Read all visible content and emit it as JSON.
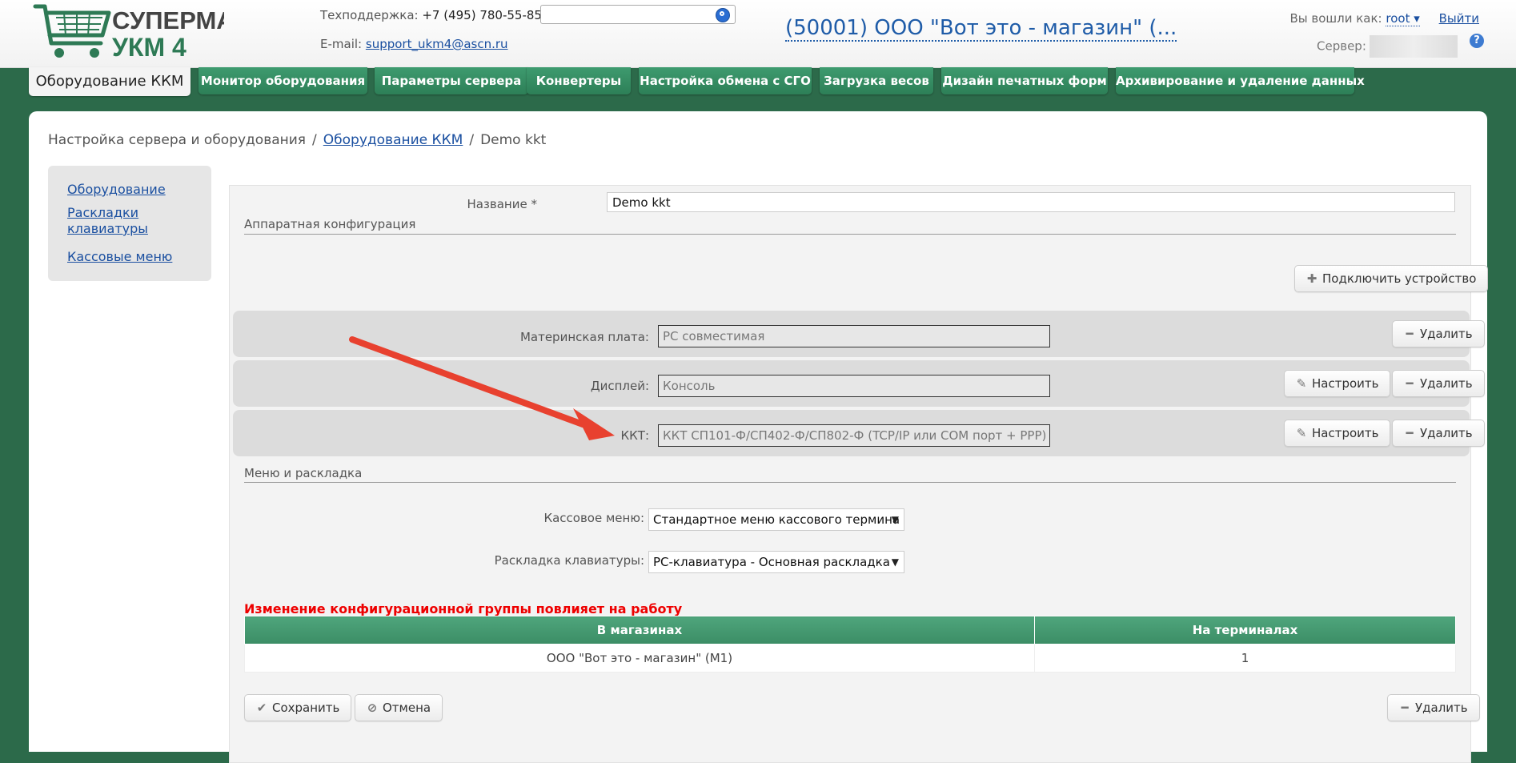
{
  "header": {
    "brand_line1": "СУПЕРМАГ",
    "brand_line2": "УКМ 4",
    "support_label": "Техподдержка:",
    "support_phone": "+7 (495) 780-55-85",
    "email_label": "E-mail:",
    "email": "support_ukm4@ascn.ru",
    "search_value": "",
    "org_title": "(50001) ООО \"Вот это - магазин\" (...",
    "logged_in_label": "Вы вошли как:",
    "user": "root",
    "logout": "Выйти",
    "server_label": "Сервер:",
    "help": "?"
  },
  "tabs": [
    {
      "label": "Оборудование ККМ",
      "active": true
    },
    {
      "label": "Монитор оборудования"
    },
    {
      "label": "Параметры сервера"
    },
    {
      "label": "Конвертеры"
    },
    {
      "label": "Настройка обмена с СГО"
    },
    {
      "label": "Загрузка весов"
    },
    {
      "label": "Дизайн печатных форм"
    },
    {
      "label": "Архивирование и удаление данных"
    }
  ],
  "breadcrumb": {
    "root": "Настройка сервера и оборудования",
    "sep": "/",
    "link": "Оборудование ККМ",
    "current": "Demo kkt"
  },
  "sidebar": {
    "items": [
      "Оборудование",
      "Раскладки клавиатуры",
      "Кассовые меню"
    ]
  },
  "form": {
    "name_label": "Название *",
    "name_value": "Demo kkt",
    "hardware_section": "Аппаратная конфигурация",
    "connect_button": "Подключить устройство",
    "devices": [
      {
        "label": "Материнская плата:",
        "value": "PC совместимая",
        "delete": "Удалить"
      },
      {
        "label": "Дисплей:",
        "value": "Консоль",
        "configure": "Настроить",
        "delete": "Удалить"
      },
      {
        "label": "ККТ:",
        "value": "ККТ СП101-Ф/СП402-Ф/СП802-Ф (TCP/IP или COM порт + PPP)",
        "configure": "Настроить",
        "delete": "Удалить"
      }
    ],
    "menu_section": "Меню и раскладка",
    "cash_menu_label": "Кассовое меню:",
    "cash_menu_value": "Стандартное меню кассового термина",
    "keyboard_label": "Раскладка клавиатуры:",
    "keyboard_value": "PC-клавиатура - Основная раскладка",
    "warning": "Изменение конфигурационной группы повлияет на работу",
    "table": {
      "headers": [
        "В магазинах",
        "На терминалах"
      ],
      "rows": [
        [
          "ООО \"Вот это - магазин\" (М1)",
          "1"
        ]
      ]
    },
    "save_button": "Сохранить",
    "cancel_button": "Отмена",
    "delete_button": "Удалить"
  },
  "colors": {
    "accent_green": "#2c6a4a",
    "tab_green": "#3e9b6f",
    "link_blue": "#1a4fa0",
    "warning_red": "#e00000",
    "annotation_arrow": "#e8412f"
  }
}
